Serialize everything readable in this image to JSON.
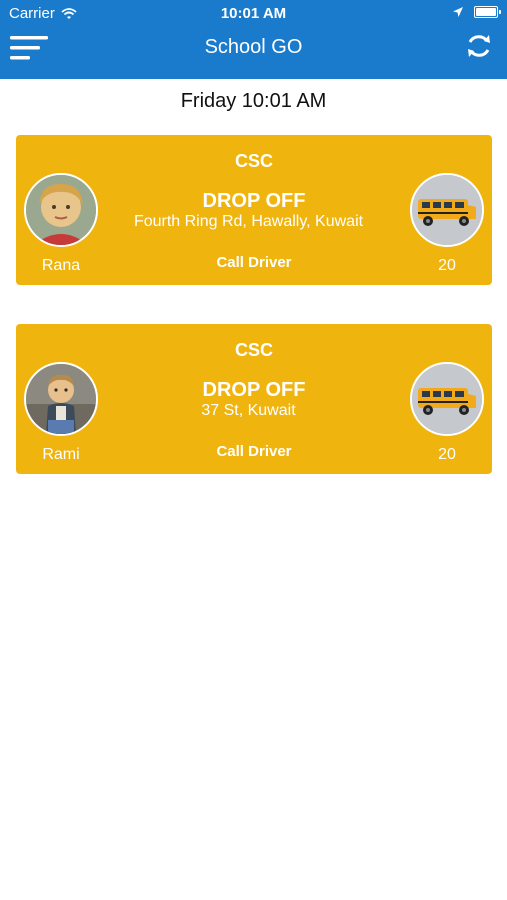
{
  "status_bar": {
    "carrier": "Carrier",
    "time": "10:01 AM"
  },
  "nav": {
    "title": "School GO",
    "menu_icon": "menu-icon",
    "refresh_icon": "refresh-icon"
  },
  "date_label": "Friday 10:01 AM",
  "trips": [
    {
      "school": "CSC",
      "status": "DROP OFF",
      "address": "Fourth Ring Rd, Hawally, Kuwait",
      "call_label": "Call Driver",
      "child_name": "Rana",
      "bus_number": "20"
    },
    {
      "school": "CSC",
      "status": "DROP OFF",
      "address": "37 St, Kuwait",
      "call_label": "Call Driver",
      "child_name": "Rami",
      "bus_number": "20"
    }
  ],
  "colors": {
    "header": "#1a7bcc",
    "card": "#f0b40f",
    "text_on_color": "#ffffff"
  }
}
